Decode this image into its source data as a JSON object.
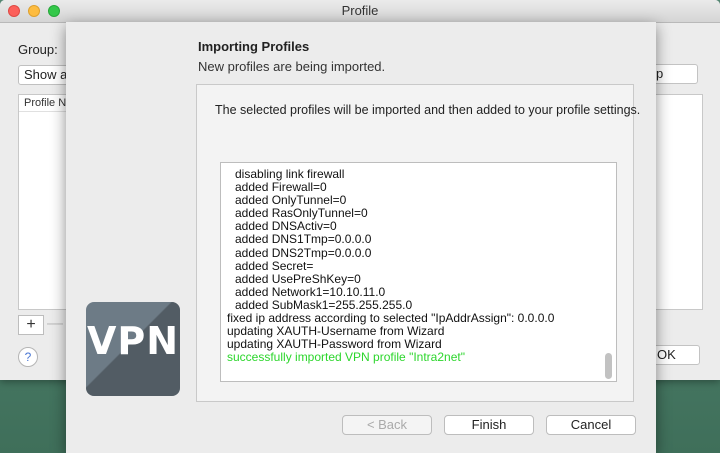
{
  "window": {
    "title": "Profile",
    "group_label": "Group:",
    "group_select_value": "Show a",
    "list_header": "Profile N",
    "right_button_label": "p",
    "ok_button_label": "OK",
    "plus_label": "+",
    "minus_label": "—",
    "help_label": "?"
  },
  "sheet": {
    "title": "Importing Profiles",
    "subtitle": "New profiles are being imported.",
    "info": "The selected profiles will be imported and then added to your profile settings.",
    "log": [
      {
        "text": "disabling link firewall",
        "indent": true
      },
      {
        "text": "added Firewall=0",
        "indent": true
      },
      {
        "text": "added OnlyTunnel=0",
        "indent": true
      },
      {
        "text": "added RasOnlyTunnel=0",
        "indent": true
      },
      {
        "text": "added DNSActiv=0",
        "indent": true
      },
      {
        "text": "added DNS1Tmp=0.0.0.0",
        "indent": true
      },
      {
        "text": "added DNS2Tmp=0.0.0.0",
        "indent": true
      },
      {
        "text": "added Secret=",
        "indent": true
      },
      {
        "text": "added UsePreShKey=0",
        "indent": true
      },
      {
        "text": "added Network1=10.10.11.0",
        "indent": true
      },
      {
        "text": "added SubMask1=255.255.255.0",
        "indent": true
      },
      {
        "text": "fixed ip address according to selected \"IpAddrAssign\": 0.0.0.0",
        "indent": false
      },
      {
        "text": "updating XAUTH-Username from Wizard",
        "indent": false
      },
      {
        "text": "updating XAUTH-Password from Wizard",
        "indent": false
      },
      {
        "text": "successfully imported VPN profile \"Intra2net\"",
        "indent": false,
        "success": true
      }
    ],
    "logo_text": "VPN",
    "buttons": {
      "back": "< Back",
      "finish": "Finish",
      "cancel": "Cancel"
    }
  },
  "colors": {
    "success": "#2cd62c",
    "logo_bg": "#6d7b86"
  }
}
